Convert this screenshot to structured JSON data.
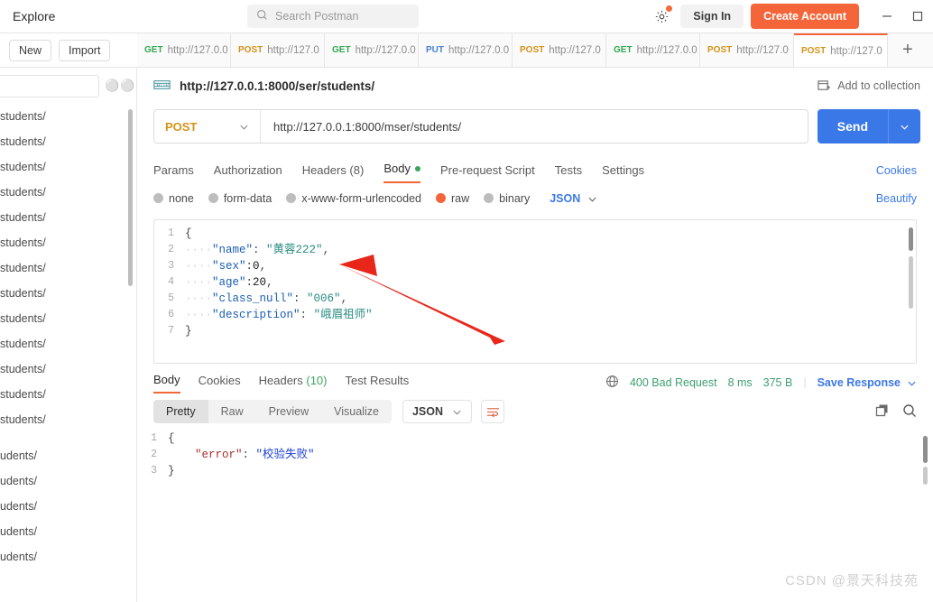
{
  "topbar": {
    "explore": "Explore",
    "search_placeholder": "Search Postman",
    "gear_icon": "gear-icon",
    "signin": "Sign In",
    "create_account": "Create Account",
    "minimize": "minimize-icon",
    "maximize": "maximize-icon"
  },
  "tabstrip": {
    "new_label": "New",
    "import_label": "Import",
    "plus_label": "+",
    "tabs": [
      {
        "method": "GET",
        "url": "http://127.0.0",
        "active": false
      },
      {
        "method": "POST",
        "url": "http://127.0",
        "active": false
      },
      {
        "method": "GET",
        "url": "http://127.0.0",
        "active": false
      },
      {
        "method": "PUT",
        "url": "http://127.0.0",
        "active": false
      },
      {
        "method": "POST",
        "url": "http://127.0",
        "active": false
      },
      {
        "method": "GET",
        "url": "http://127.0.0",
        "active": false
      },
      {
        "method": "POST",
        "url": "http://127.0",
        "active": false
      },
      {
        "method": "POST",
        "url": "http://127.0",
        "active": true
      }
    ]
  },
  "sidebar": {
    "search_value": "",
    "more_icon": "more-options-icon",
    "items": [
      "students/",
      "students/",
      "students/",
      "students/",
      "students/",
      "students/",
      "students/",
      "students/",
      "students/",
      "students/",
      "students/",
      "students/",
      "students/",
      "udents/",
      "udents/",
      "udents/",
      "udents/",
      "udents/"
    ]
  },
  "request": {
    "breadcrumb_icon": "http-icon",
    "breadcrumb_url": "http://127.0.0.1:8000/ser/students/",
    "add_to_collection": "Add to collection",
    "add_to_collection_icon": "add-to-collection-icon",
    "method": "POST",
    "url": "http://127.0.0.1:8000/mser/students/",
    "send_label": "Send",
    "tabs": [
      {
        "label": "Params",
        "active": false
      },
      {
        "label": "Authorization",
        "active": false
      },
      {
        "label": "Headers (8)",
        "active": false
      },
      {
        "label": "Body",
        "active": true,
        "dot": true
      },
      {
        "label": "Pre-request Script",
        "active": false
      },
      {
        "label": "Tests",
        "active": false
      },
      {
        "label": "Settings",
        "active": false
      }
    ],
    "cookies_link": "Cookies",
    "body_types": [
      {
        "label": "none",
        "selected": false
      },
      {
        "label": "form-data",
        "selected": false
      },
      {
        "label": "x-www-form-urlencoded",
        "selected": false
      },
      {
        "label": "raw",
        "selected": true
      },
      {
        "label": "binary",
        "selected": false
      }
    ],
    "body_format": "JSON",
    "beautify": "Beautify",
    "body_lines": [
      {
        "n": "1",
        "tokens": [
          {
            "t": "{",
            "c": "p"
          }
        ]
      },
      {
        "n": "2",
        "tokens": [
          {
            "t": "····",
            "c": "ind"
          },
          {
            "t": "\"name\"",
            "c": "k"
          },
          {
            "t": ": ",
            "c": "p"
          },
          {
            "t": "\"黄蓉222\"",
            "c": "s"
          },
          {
            "t": ",",
            "c": "p"
          }
        ]
      },
      {
        "n": "3",
        "tokens": [
          {
            "t": "····",
            "c": "ind"
          },
          {
            "t": "\"sex\"",
            "c": "k"
          },
          {
            "t": ":",
            "c": "p"
          },
          {
            "t": "0",
            "c": "n"
          },
          {
            "t": ",",
            "c": "p"
          }
        ]
      },
      {
        "n": "4",
        "tokens": [
          {
            "t": "····",
            "c": "ind"
          },
          {
            "t": "\"age\"",
            "c": "k"
          },
          {
            "t": ":",
            "c": "p"
          },
          {
            "t": "20",
            "c": "n"
          },
          {
            "t": ",",
            "c": "p"
          }
        ]
      },
      {
        "n": "5",
        "tokens": [
          {
            "t": "····",
            "c": "ind"
          },
          {
            "t": "\"class_null\"",
            "c": "k"
          },
          {
            "t": ": ",
            "c": "p"
          },
          {
            "t": "\"006\"",
            "c": "s"
          },
          {
            "t": ",",
            "c": "p"
          }
        ]
      },
      {
        "n": "6",
        "tokens": [
          {
            "t": "····",
            "c": "ind"
          },
          {
            "t": "\"description\"",
            "c": "k"
          },
          {
            "t": ": ",
            "c": "p"
          },
          {
            "t": "\"峨眉祖师\"",
            "c": "s"
          }
        ]
      },
      {
        "n": "7",
        "tokens": [
          {
            "t": "}",
            "c": "p"
          }
        ]
      }
    ]
  },
  "response": {
    "tabs": [
      {
        "label": "Body",
        "count": "",
        "active": true
      },
      {
        "label": "Cookies",
        "count": "",
        "active": false
      },
      {
        "label": "Headers",
        "count": "(10)",
        "active": false
      },
      {
        "label": "Test Results",
        "count": "",
        "active": false
      }
    ],
    "globe_icon": "globe-icon",
    "status": "400 Bad Request",
    "time": "8 ms",
    "size": "375 B",
    "save_response": "Save Response",
    "view_modes": [
      {
        "label": "Pretty",
        "active": true
      },
      {
        "label": "Raw",
        "active": false
      },
      {
        "label": "Preview",
        "active": false
      },
      {
        "label": "Visualize",
        "active": false
      }
    ],
    "format": "JSON",
    "wrap_icon": "wrap-lines-icon",
    "copy_icon": "copy-icon",
    "search_icon": "search-icon",
    "body_lines": [
      {
        "n": "1",
        "tokens": [
          {
            "t": "{",
            "c": "p"
          }
        ]
      },
      {
        "n": "2",
        "tokens": [
          {
            "t": "    ",
            "c": "ind"
          },
          {
            "t": "\"error\"",
            "c": "rk"
          },
          {
            "t": ": ",
            "c": "p"
          },
          {
            "t": "\"校验失败\"",
            "c": "rs"
          }
        ]
      },
      {
        "n": "3",
        "tokens": [
          {
            "t": "}",
            "c": "p"
          }
        ]
      }
    ]
  },
  "watermark": "CSDN @景天科技苑",
  "colors": {
    "accent": "#f4663a",
    "send": "#3b78e7",
    "get": "#34a853",
    "post": "#d4921a",
    "put": "#4a7fd4",
    "status_ok": "#3ca06f",
    "annotation_arrow": "#e8271a"
  }
}
